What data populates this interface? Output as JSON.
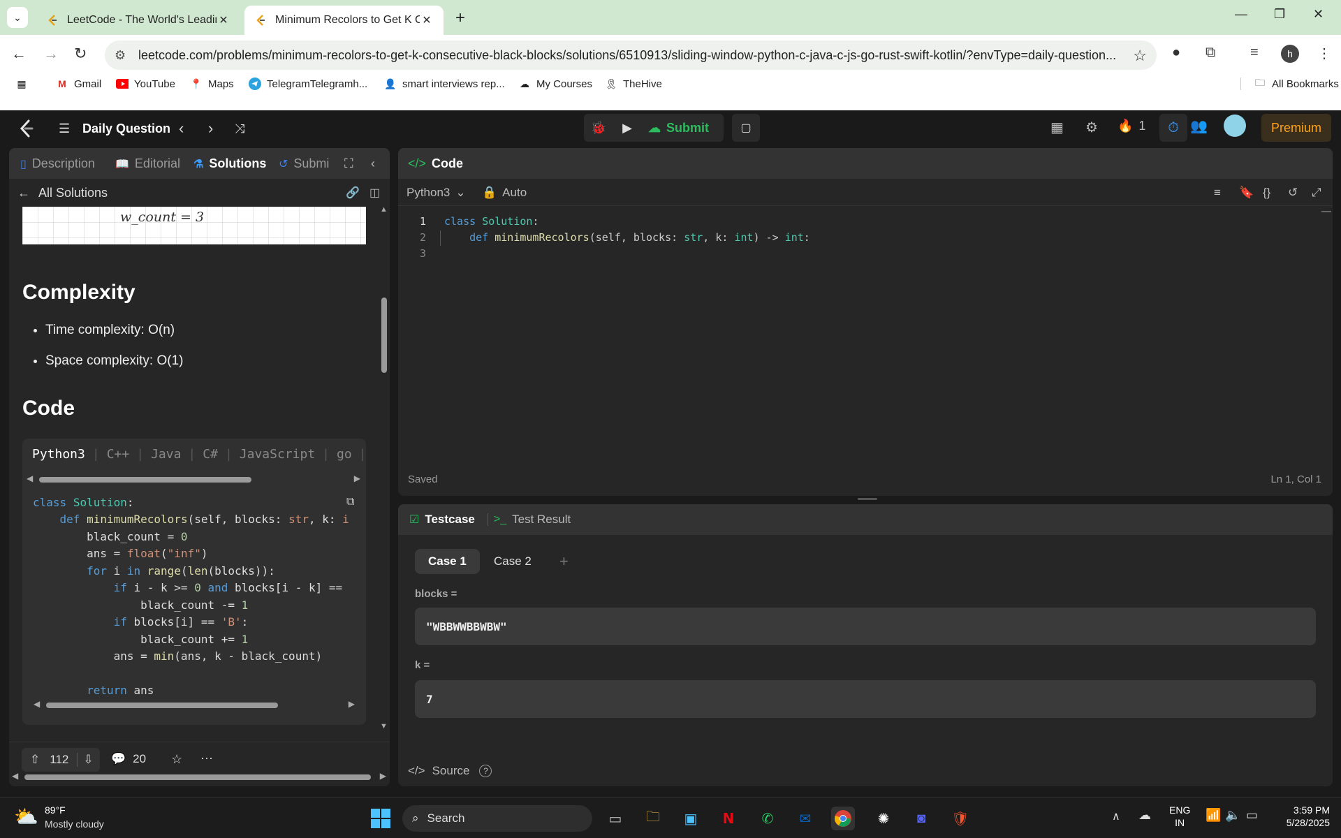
{
  "browser": {
    "tabs": [
      {
        "title": "LeetCode - The World's Leading",
        "active": false
      },
      {
        "title": "Minimum Recolors to Get K Con",
        "active": true
      }
    ],
    "url": "leetcode.com/problems/minimum-recolors-to-get-k-consecutive-black-blocks/solutions/6510913/sliding-window-python-c-java-c-js-go-rust-swift-kotlin/?envType=daily-question...",
    "profile_initial": "h",
    "bookmarks": [
      "Gmail",
      "YouTube",
      "Maps",
      "TelegramTelegramh...",
      "smart interviews rep...",
      "My Courses",
      "TheHive"
    ],
    "all_bookmarks": "All Bookmarks"
  },
  "lc_header": {
    "daily_question": "Daily Question",
    "submit": "Submit",
    "streak": "1",
    "premium": "Premium"
  },
  "left_panel": {
    "tabs": [
      "Description",
      "Editorial",
      "Solutions",
      "Submi"
    ],
    "back_label": "All Solutions",
    "handwriting": "w_count = 3",
    "complexity_heading": "Complexity",
    "complexity_items": [
      "Time complexity: O(n)",
      "Space complexity: O(1)"
    ],
    "code_heading": "Code",
    "lang_tabs": [
      "Python3",
      "C++",
      "Java",
      "C#",
      "JavaScript",
      "go"
    ],
    "upvotes": "112",
    "comments": "20"
  },
  "code_panel": {
    "title": "Code",
    "language": "Python3",
    "mode": "Auto",
    "lines": [
      {
        "n": "1",
        "text": "class Solution:"
      },
      {
        "n": "2",
        "text": "    def minimumRecolors(self, blocks: str, k: int) -> int:"
      },
      {
        "n": "3",
        "text": ""
      }
    ],
    "status": "Saved",
    "cursor": "Ln 1, Col 1"
  },
  "test_panel": {
    "tab_testcase": "Testcase",
    "tab_result": "Test Result",
    "cases": [
      "Case 1",
      "Case 2"
    ],
    "blocks_label": "blocks =",
    "blocks_value": "\"WBBWWBBWBW\"",
    "k_label": "k =",
    "k_value": "7",
    "source": "Source"
  },
  "taskbar": {
    "temp": "89°F",
    "weather": "Mostly cloudy",
    "search": "Search",
    "lang1": "ENG",
    "lang2": "IN",
    "time": "3:59 PM",
    "date": "5/28/2025"
  },
  "colors": {
    "accent_green": "#2cbb5d",
    "premium": "#ffa116",
    "panel_bg": "#262626"
  }
}
